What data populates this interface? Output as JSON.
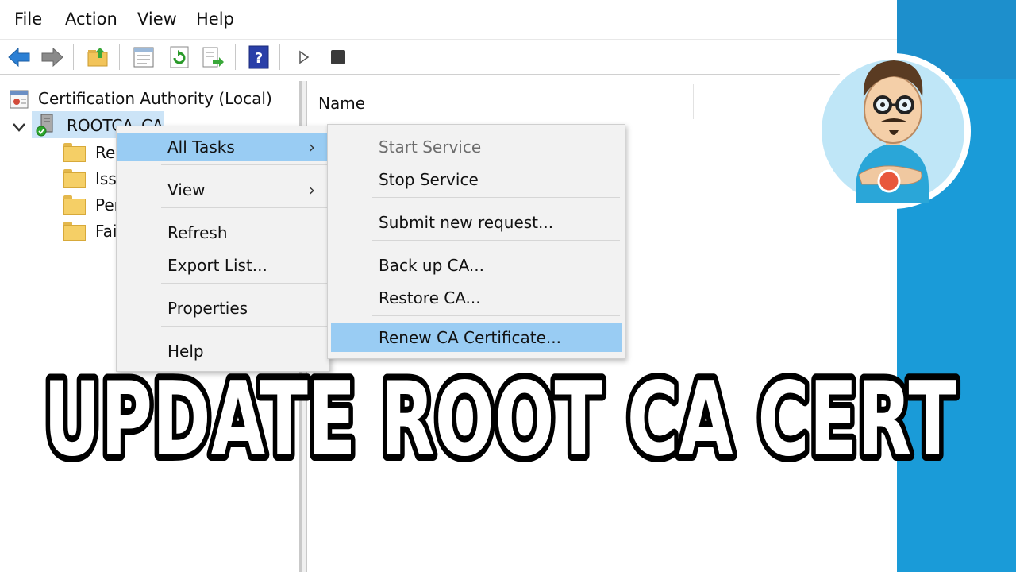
{
  "menubar": {
    "file": "File",
    "action": "Action",
    "view": "View",
    "help": "Help"
  },
  "tree": {
    "root_label": "Certification Authority (Local)",
    "ca_name": "ROOTCA_CA",
    "children": [
      "Rev",
      "Iss",
      "Per",
      "Fai"
    ]
  },
  "list": {
    "column_name": "Name"
  },
  "context_menu": {
    "all_tasks": "All Tasks",
    "view": "View",
    "refresh": "Refresh",
    "export_list": "Export List...",
    "properties": "Properties",
    "help": "Help"
  },
  "submenu": {
    "start_service": "Start Service",
    "stop_service": "Stop Service",
    "submit_request": "Submit new request...",
    "backup_ca": "Back up CA...",
    "restore_ca": "Restore CA...",
    "renew_ca": "Renew CA Certificate..."
  },
  "banner_text": "UPDATE ROOT CA CERT",
  "colors": {
    "highlight": "#99ccf3",
    "side_panel": "#1a9bd8"
  },
  "icons": [
    "back-arrow-icon",
    "forward-arrow-icon",
    "up-folder-icon",
    "properties-icon",
    "refresh-icon",
    "export-icon",
    "help-icon",
    "play-icon",
    "stop-icon",
    "folder-icon",
    "server-icon"
  ]
}
